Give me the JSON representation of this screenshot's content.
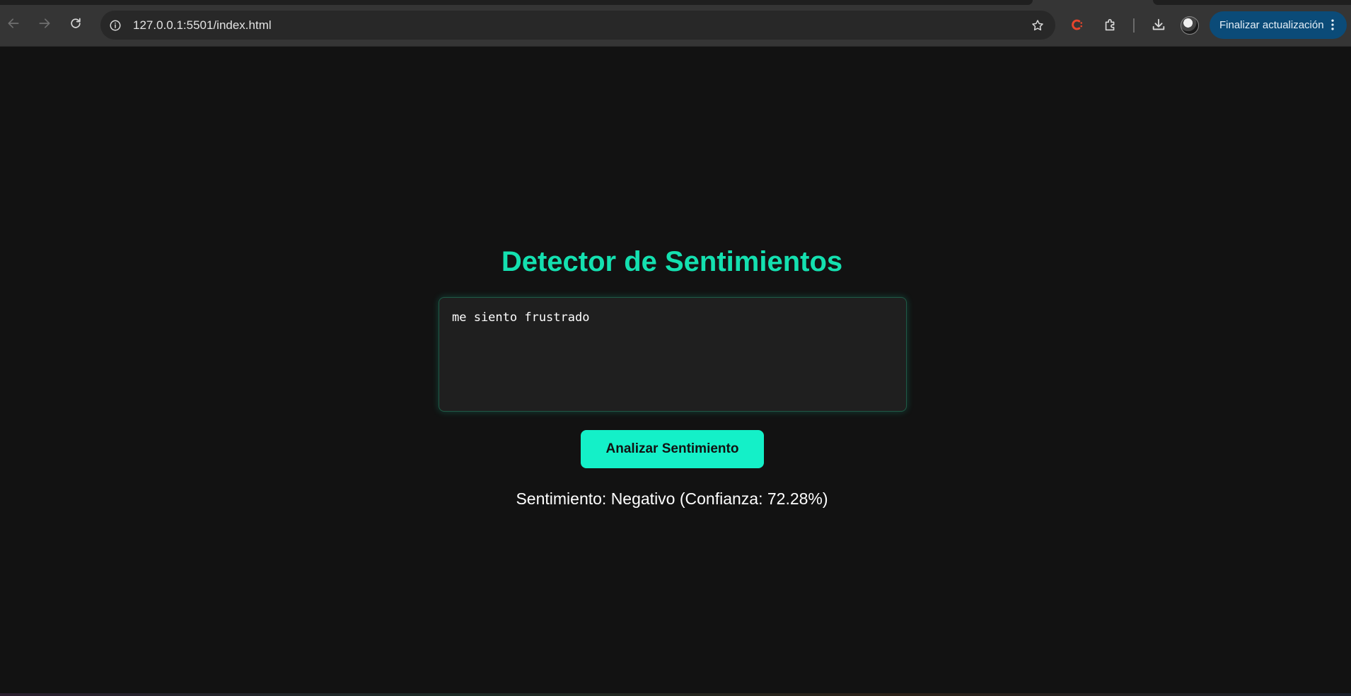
{
  "browser": {
    "url": "127.0.0.1:5501/index.html",
    "update_label": "Finalizar actualización",
    "icons": {
      "back": "arrow-left-icon",
      "forward": "arrow-right-icon",
      "reload": "reload-icon",
      "site_info": "info-icon",
      "bookmark": "star-icon",
      "extension_c": "extension-c-icon",
      "extensions": "puzzle-icon",
      "downloads": "download-icon",
      "menu": "kebab-menu-icon"
    }
  },
  "app": {
    "title": "Detector de Sentimientos",
    "input_value": "me siento frustrado",
    "analyze_label": "Analizar Sentimiento",
    "result_text": "Sentimiento: Negativo (Confianza: 72.28%)",
    "accent_color": "#14e0b0",
    "button_color": "#14f0c8",
    "background_color": "#121212"
  }
}
